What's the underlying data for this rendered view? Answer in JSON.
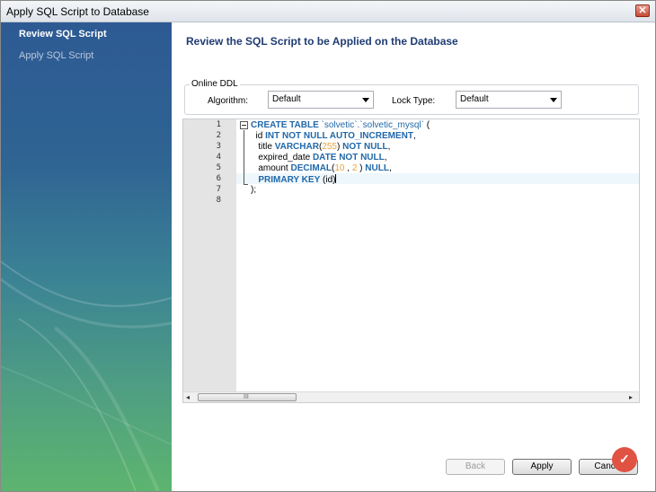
{
  "window": {
    "title": "Apply SQL Script to Database",
    "close_glyph": "✕"
  },
  "sidebar": {
    "steps": [
      {
        "label": "Review SQL Script"
      },
      {
        "label": "Apply SQL Script"
      }
    ]
  },
  "main": {
    "title": "Review the SQL Script to be Applied on the Database",
    "online_ddl": {
      "legend": "Online DDL",
      "algorithm_label": "Algorithm:",
      "algorithm_value": "Default",
      "lock_type_label": "Lock Type:",
      "lock_type_value": "Default"
    },
    "editor": {
      "line_numbers": [
        "1",
        "2",
        "3",
        "4",
        "5",
        "6",
        "7",
        "8"
      ],
      "lines": [
        {
          "tokens": [
            {
              "t": "CREATE TABLE ",
              "c": "kw"
            },
            {
              "t": "`solvetic`.`solvetic_mysql`",
              "c": "str"
            },
            {
              "t": " (",
              "c": ""
            }
          ]
        },
        {
          "tokens": [
            {
              "t": "  id ",
              "c": ""
            },
            {
              "t": "INT NOT NULL AUTO_INCREMENT",
              "c": "kw"
            },
            {
              "t": ",",
              "c": ""
            }
          ]
        },
        {
          "tokens": [
            {
              "t": "   title ",
              "c": ""
            },
            {
              "t": "VARCHAR",
              "c": "kw"
            },
            {
              "t": "(",
              "c": ""
            },
            {
              "t": "255",
              "c": "num"
            },
            {
              "t": ") ",
              "c": ""
            },
            {
              "t": "NOT NULL",
              "c": "kw"
            },
            {
              "t": ",",
              "c": ""
            }
          ]
        },
        {
          "tokens": [
            {
              "t": "   expired_date ",
              "c": ""
            },
            {
              "t": "DATE NOT NULL",
              "c": "kw"
            },
            {
              "t": ",",
              "c": ""
            }
          ]
        },
        {
          "tokens": [
            {
              "t": "   amount ",
              "c": ""
            },
            {
              "t": "DECIMAL",
              "c": "kw"
            },
            {
              "t": "(",
              "c": ""
            },
            {
              "t": "10",
              "c": "num"
            },
            {
              "t": " , ",
              "c": ""
            },
            {
              "t": "2",
              "c": "num"
            },
            {
              "t": " ) ",
              "c": ""
            },
            {
              "t": "NULL",
              "c": "kw"
            },
            {
              "t": ",",
              "c": ""
            }
          ]
        },
        {
          "tokens": [
            {
              "t": "   ",
              "c": ""
            },
            {
              "t": "PRIMARY KEY",
              "c": "kw"
            },
            {
              "t": " (id)",
              "c": ""
            }
          ]
        },
        {
          "tokens": [
            {
              "t": ");",
              "c": ""
            }
          ]
        },
        {
          "tokens": []
        }
      ],
      "scroll_left_glyph": "◂",
      "scroll_right_glyph": "▸",
      "scroll_grip": "III"
    }
  },
  "buttons": {
    "back": "Back",
    "apply": "Apply",
    "cancel": "Cancel"
  },
  "colors": {
    "title_blue": "#1f3c73",
    "keyword_blue": "#2168a9",
    "number_orange": "#e6a23c",
    "watermark_red": "#e05242"
  }
}
